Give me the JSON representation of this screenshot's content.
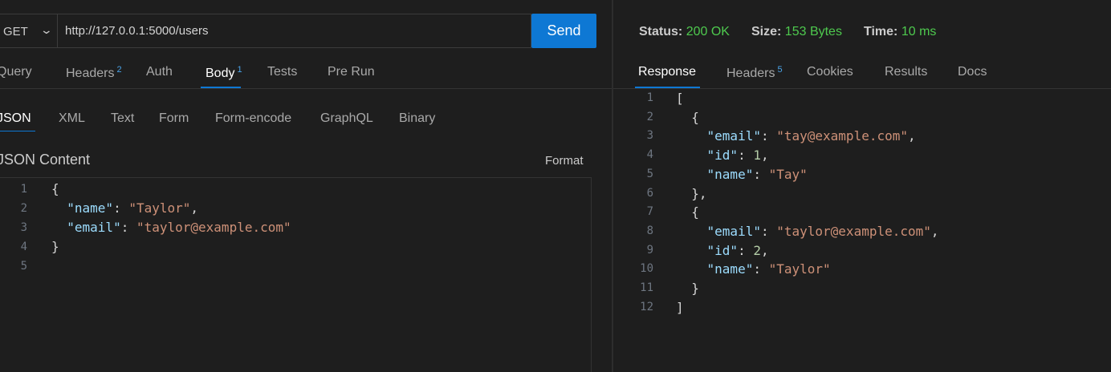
{
  "request": {
    "method": "GET",
    "url": "http://127.0.0.1:5000/users",
    "send_label": "Send",
    "tabs": [
      {
        "label": "Query"
      },
      {
        "label": "Headers",
        "badge": "2"
      },
      {
        "label": "Auth"
      },
      {
        "label": "Body",
        "badge": "1",
        "active": true
      },
      {
        "label": "Tests"
      },
      {
        "label": "Pre Run"
      }
    ],
    "body_tabs": [
      {
        "label": "JSON",
        "active": true
      },
      {
        "label": "XML"
      },
      {
        "label": "Text"
      },
      {
        "label": "Form"
      },
      {
        "label": "Form-encode"
      },
      {
        "label": "GraphQL"
      },
      {
        "label": "Binary"
      }
    ],
    "content_title": "JSON Content",
    "format_label": "Format",
    "line_numbers": [
      "1",
      "2",
      "3",
      "4",
      "5"
    ],
    "body_lines": [
      "{",
      "  \"name\": \"Taylor\",",
      "  \"email\": \"taylor@example.com\"",
      "}",
      ""
    ]
  },
  "response": {
    "status_label": "Status:",
    "status_value": "200 OK",
    "size_label": "Size:",
    "size_value": "153 Bytes",
    "time_label": "Time:",
    "time_value": "10 ms",
    "tabs": [
      {
        "label": "Response",
        "active": true
      },
      {
        "label": "Headers",
        "badge": "5"
      },
      {
        "label": "Cookies"
      },
      {
        "label": "Results"
      },
      {
        "label": "Docs"
      }
    ],
    "line_numbers": [
      "1",
      "2",
      "3",
      "4",
      "5",
      "6",
      "7",
      "8",
      "9",
      "10",
      "11",
      "12"
    ],
    "body_lines": [
      "[",
      "  {",
      "    \"email\": \"tay@example.com\",",
      "    \"id\": 1,",
      "    \"name\": \"Tay\"",
      "  },",
      "  {",
      "    \"email\": \"taylor@example.com\",",
      "    \"id\": 2,",
      "    \"name\": \"Taylor\"",
      "  }",
      "]"
    ]
  },
  "colors": {
    "accent": "#0e78d4",
    "status_ok": "#4ec94e",
    "json_key": "#9cdcfe",
    "json_string": "#ce9178",
    "json_number": "#b5cea8"
  }
}
